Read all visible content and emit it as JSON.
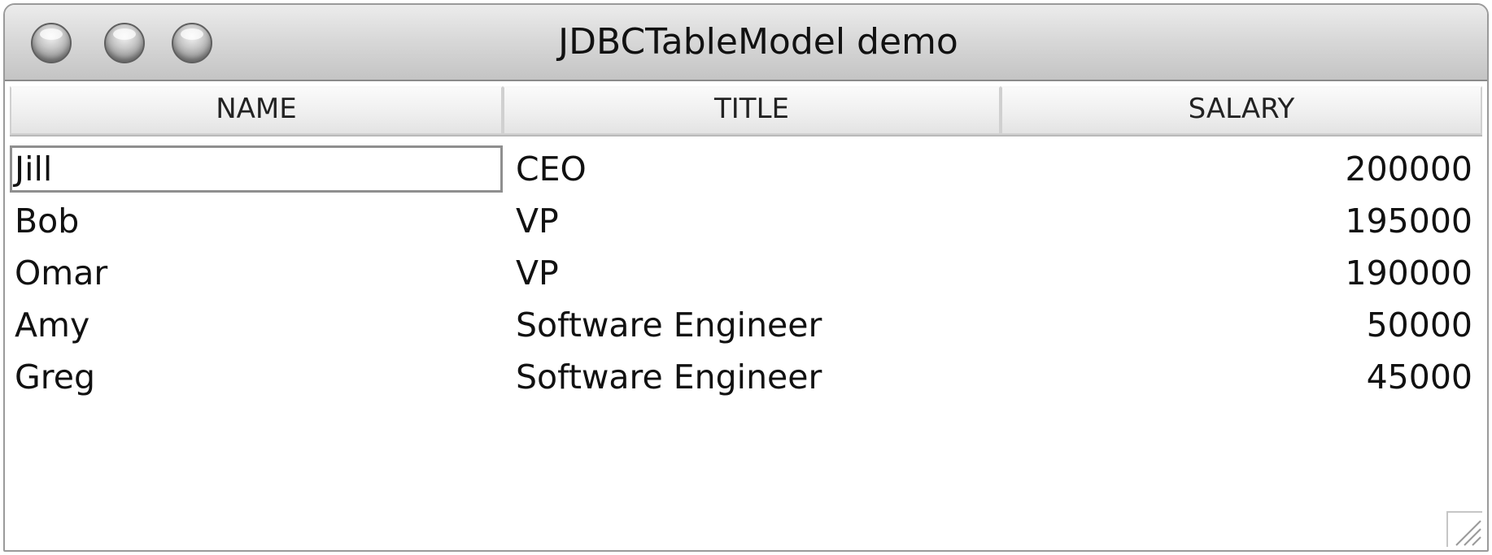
{
  "window": {
    "title": "JDBCTableModel demo",
    "controls": [
      "close-icon",
      "minimize-icon",
      "zoom-icon"
    ]
  },
  "table": {
    "columns": [
      "NAME",
      "TITLE",
      "SALARY"
    ],
    "rows": [
      {
        "name": "Jill",
        "title": "CEO",
        "salary": "200000"
      },
      {
        "name": "Bob",
        "title": "VP",
        "salary": "195000"
      },
      {
        "name": "Omar",
        "title": "VP",
        "salary": "190000"
      },
      {
        "name": "Amy",
        "title": "Software Engineer",
        "salary": "50000"
      },
      {
        "name": "Greg",
        "title": "Software Engineer",
        "salary": "45000"
      }
    ],
    "selected_row": 0
  },
  "colors": {
    "title_bar": "#d9d9d9",
    "header_bg": "#eeeeee",
    "text": "#111111"
  }
}
